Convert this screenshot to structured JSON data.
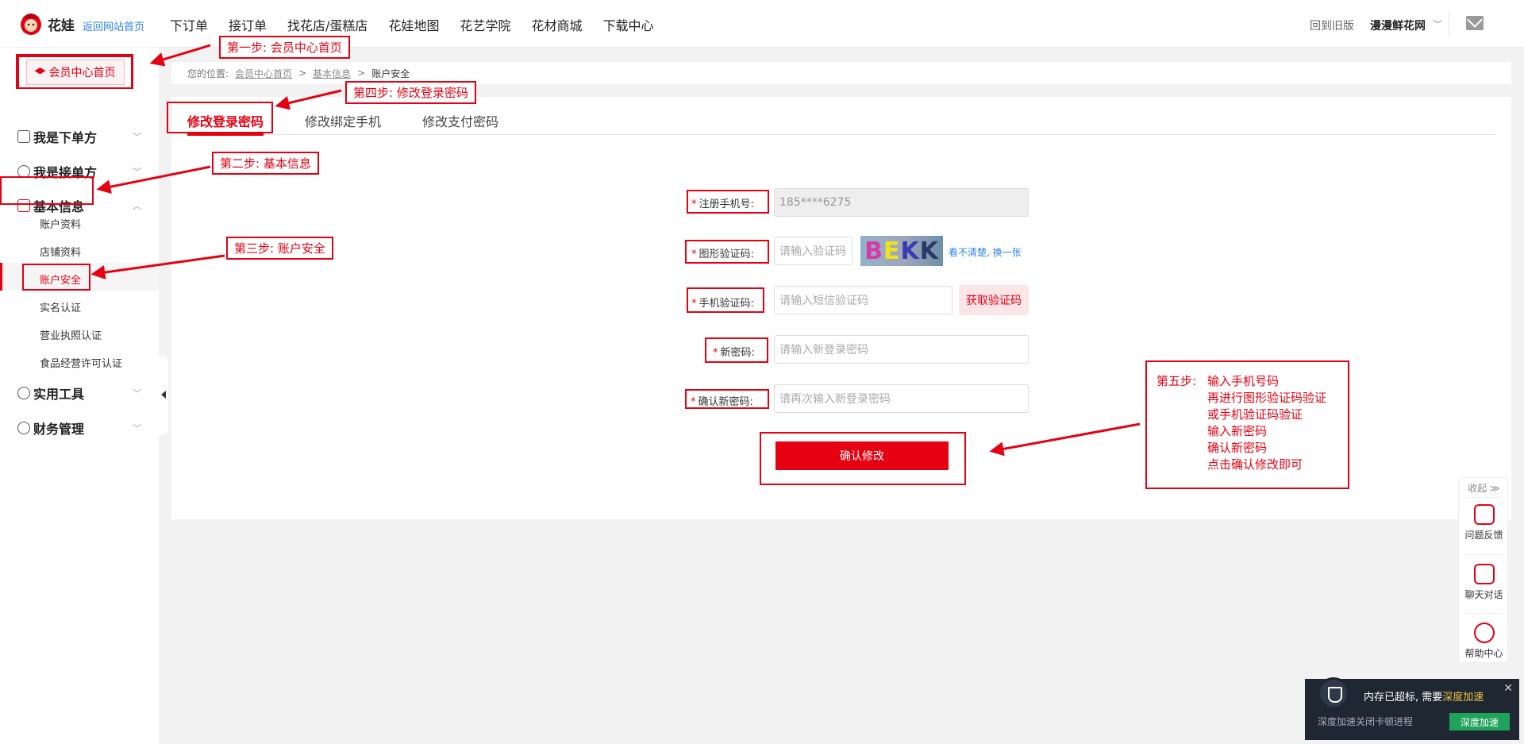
{
  "header": {
    "logo_text": "花娃",
    "back_link": "返回网站首页",
    "nav": [
      "下订单",
      "接订单",
      "找花店/蛋糕店",
      "花娃地图",
      "花艺学院",
      "花材商城",
      "下载中心"
    ],
    "old_version": "回到旧版",
    "user_name": "漫漫鲜花网"
  },
  "sidebar": {
    "home": "会员中心首页",
    "menus": [
      {
        "label": "我是下单方",
        "chev": "﹀"
      },
      {
        "label": "我是接单方",
        "chev": "﹀"
      },
      {
        "label": "基本信息",
        "chev": "︿"
      },
      {
        "label": "实用工具",
        "chev": "﹀"
      },
      {
        "label": "财务管理",
        "chev": "﹀"
      }
    ],
    "submenu": [
      "账户资料",
      "店铺资料",
      "账户安全",
      "实名认证",
      "营业执照认证",
      "食品经营许可认证"
    ]
  },
  "breadcrumb": {
    "prefix": "您的位置:",
    "items": [
      "会员中心首页",
      "基本信息",
      "账户安全"
    ],
    "sep": ">"
  },
  "tabs": [
    "修改登录密码",
    "修改绑定手机",
    "修改支付密码"
  ],
  "form": {
    "phone_label": "注册手机号:",
    "phone_value": "185****6275",
    "captcha_label": "图形验证码:",
    "captcha_placeholder": "请输入验证码",
    "captcha_chars": [
      "B",
      "E",
      "K",
      "K"
    ],
    "captcha_refresh": "看不清楚, 换一张",
    "sms_label": "手机验证码:",
    "sms_placeholder": "请输入短信验证码",
    "sms_button": "获取验证码",
    "new_pwd_label": "新密码:",
    "new_pwd_placeholder": "请输入新登录密码",
    "confirm_pwd_label": "确认新密码:",
    "confirm_pwd_placeholder": "请再次输入新登录密码",
    "submit": "确认修改",
    "required_mark": "*"
  },
  "annotations": {
    "step1": "第一步: 会员中心首页",
    "step2": "第二步: 基本信息",
    "step3": "第三步: 账户安全",
    "step4": "第四步: 修改登录密码",
    "step5_head": "第五步:",
    "step5_lines": [
      "输入手机号码",
      "再进行图形验证码验证",
      "或手机验证码验证",
      "输入新密码",
      "确认新密码",
      "点击确认修改即可"
    ],
    "color": "#e50012"
  },
  "float_tools": {
    "collapse": "收起 ≫",
    "items": [
      "问题反馈",
      "聊天对话",
      "帮助中心"
    ]
  },
  "toast": {
    "title_a": "内存已超标, 需要",
    "title_b": "深度加速",
    "sub": "深度加速关闭卡顿进程",
    "button": "深度加速",
    "close": "✕"
  }
}
